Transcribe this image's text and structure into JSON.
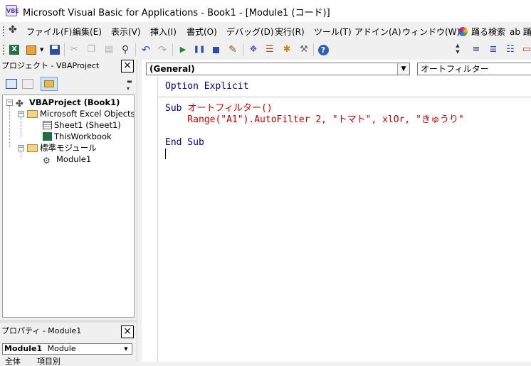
{
  "window": {
    "title": "Microsoft Visual Basic for Applications - Book1 - [Module1 (コード)]",
    "app_icon_text": "VBE"
  },
  "menu": [
    {
      "label": "ファイル(F)"
    },
    {
      "label": "編集(E)"
    },
    {
      "label": "表示(V)"
    },
    {
      "label": "挿入(I)"
    },
    {
      "label": "書式(O)"
    },
    {
      "label": "デバッグ(D)"
    },
    {
      "label": "実行(R)"
    },
    {
      "label": "ツール(T)"
    },
    {
      "label": "アドイン(A)"
    },
    {
      "label": "ウィンドウ(W)"
    },
    {
      "label": "踊る検索"
    },
    {
      "label": "ab 踊"
    }
  ],
  "toolbar_icons": [
    "excel-view-icon",
    "insert-module-icon",
    "save-icon",
    "cut-icon",
    "copy-icon",
    "paste-icon",
    "find-icon",
    "undo-icon",
    "redo-icon",
    "run-icon",
    "break-icon",
    "reset-icon",
    "design-mode-icon",
    "project-explorer-icon",
    "properties-icon",
    "object-browser-icon",
    "toolbox-icon",
    "help-icon"
  ],
  "project_panel": {
    "title": "プロジェクト - VBAProject",
    "close": "×",
    "tree": [
      {
        "label": "VBAProject (Book1)",
        "bold": true
      },
      {
        "label": "Microsoft Excel Objects"
      },
      {
        "label": "Sheet1 (Sheet1)"
      },
      {
        "label": "ThisWorkbook"
      },
      {
        "label": "標準モジュール"
      },
      {
        "label": "Module1"
      }
    ]
  },
  "properties_panel": {
    "title": "プロパティ - Module1",
    "close": "×",
    "object_name": "Module1",
    "object_type": "Module",
    "tabs": [
      "全体",
      "項目別"
    ]
  },
  "code_window": {
    "object_combo": "(General)",
    "proc_combo": "オートフィルター",
    "lines": {
      "l1_kw": "Option Explicit",
      "l2_kw": "Sub ",
      "l2_name": "オートフィルター()",
      "l3": "    Range(\"A1\").AutoFilter 2, \"トマト\", xlOr, \"きゅうり\"",
      "l4_kw": "End Sub"
    }
  }
}
